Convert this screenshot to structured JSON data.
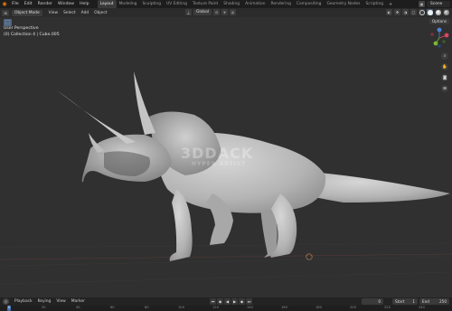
{
  "menu": {
    "items": [
      "File",
      "Edit",
      "Render",
      "Window",
      "Help"
    ]
  },
  "workspaces": {
    "tabs": [
      "Layout",
      "Modeling",
      "Sculpting",
      "UV Editing",
      "Texture Paint",
      "Shading",
      "Animation",
      "Rendering",
      "Compositing",
      "Geometry Nodes",
      "Scripting"
    ],
    "active_index": 0,
    "add_label": "+"
  },
  "scene": {
    "name": "Scene"
  },
  "header": {
    "mode": "Object Mode",
    "menus": [
      "View",
      "Select",
      "Add",
      "Object"
    ],
    "transform_orientation": "Global",
    "options_label": "Options"
  },
  "viewport": {
    "perspective_label": "User Perspective",
    "collection_label": "(0) Collection 4 | Cube.005"
  },
  "watermark": {
    "main": "3DDACK",
    "sub": "HYPER ARTIST"
  },
  "timeline": {
    "menus": [
      "Playback",
      "Keying",
      "View",
      "Marker"
    ],
    "current_frame": "0",
    "start_label": "Start",
    "start_value": "1",
    "end_label": "End",
    "end_value": "250"
  },
  "ruler": {
    "frames": [
      "0",
      "20",
      "40",
      "60",
      "80",
      "100",
      "120",
      "140",
      "160",
      "180",
      "200",
      "220",
      "240"
    ],
    "current": "0"
  },
  "colors": {
    "accent": "#4772b3",
    "logo": "#e87d0d",
    "axis_x": "#e0425e",
    "axis_y": "#7ab836",
    "axis_z": "#4d83d6"
  },
  "icons": {
    "editor_type": "3d-viewport-icon",
    "select_box": "cursor-select-icon",
    "zoom": "magnifier-icon",
    "pan": "hand-icon",
    "camera": "camera-icon",
    "ortho": "grid-icon"
  }
}
